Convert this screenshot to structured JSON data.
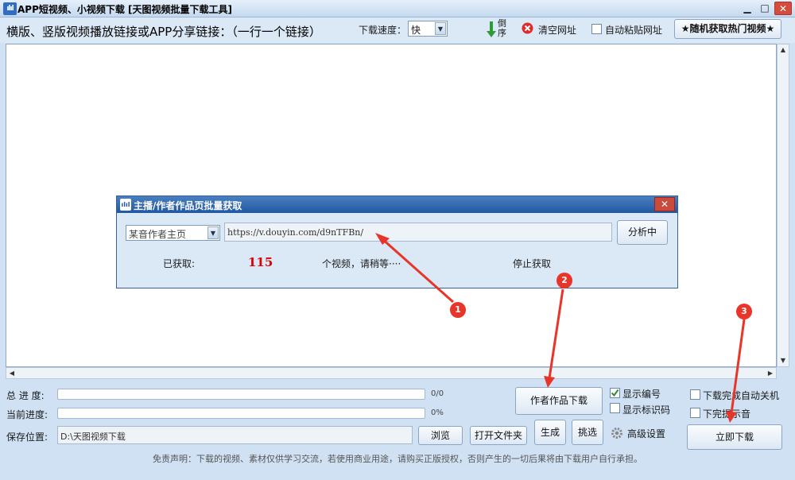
{
  "window": {
    "title": "APP短视频、小视频下载 [天图视频批量下载工具]",
    "min": "▁",
    "max": "□",
    "close": "✕",
    "icon": "ılıl"
  },
  "toolbar": {
    "hint": "横版、竖版视频播放链接或APP分享链接：（一行一个链接）",
    "speed_label": "下载速度：",
    "speed_value": "快",
    "reverse_label": "倒序",
    "clear_label": "清空网址",
    "auto_paste_label": "自动粘贴网址",
    "random_label": "★随机获取热门视频★"
  },
  "scroll": {
    "up": "▲",
    "down": "▼",
    "left": "◀",
    "right": "▶"
  },
  "dialog": {
    "title": "主播/作者作品页批量获取",
    "close": "✕",
    "source_value": "某音作者主页",
    "url_value": "https://v.douyin.com/d9nTFBn/",
    "analyze_label": "分析中",
    "fetched_label": "已获取:",
    "fetched_count": "115",
    "wait_text": "个视频，请稍等····",
    "stop_label": "停止获取"
  },
  "bottom": {
    "total_label": "总 进 度:",
    "total_pct": "0/0",
    "current_label": "当前进度:",
    "current_pct": "0%",
    "save_label": "保存位置:",
    "save_path": "D:\\天图视频下载",
    "browse_label": "浏览",
    "open_folder_label": "打开文件夹",
    "author_download_label": "作者作品下载",
    "generate_label": "生成",
    "pick_label": "挑选",
    "show_number_label": "显示编号",
    "show_mark_label": "显示标识码",
    "advanced_label": "高级设置",
    "shutdown_label": "下载完成自动关机",
    "sound_label": "下完提示音",
    "download_now_label": "立即下载",
    "disclaimer": "免责声明：下载的视频、素材仅供学习交流，若使用商业用途，请购买正版授权，否则产生的一切后果将由下载用户自行承担。"
  },
  "annotations": {
    "one": "1",
    "two": "2",
    "three": "3"
  },
  "colors": {
    "annotation": "#e8352a",
    "title_bar": "#21589f",
    "count": "#dd0000"
  }
}
